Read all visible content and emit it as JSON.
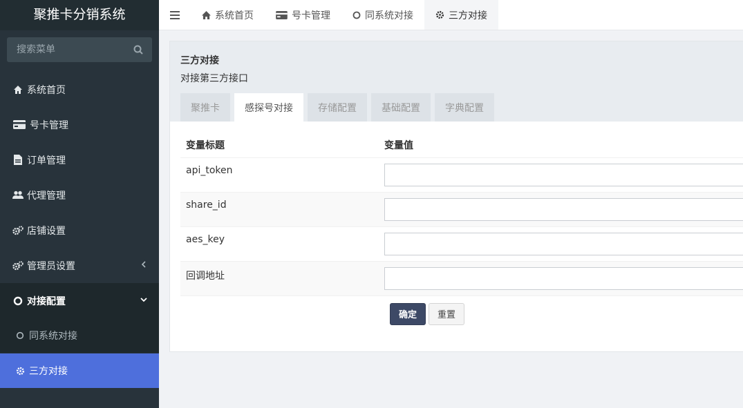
{
  "sidebar": {
    "brand": "聚推卡分销系统",
    "search_placeholder": "搜索菜单",
    "items": [
      {
        "label": "系统首页"
      },
      {
        "label": "号卡管理"
      },
      {
        "label": "订单管理"
      },
      {
        "label": "代理管理"
      },
      {
        "label": "店铺设置"
      },
      {
        "label": "管理员设置"
      },
      {
        "label": "对接配置"
      }
    ],
    "sub_items": [
      {
        "label": "同系统对接"
      },
      {
        "label": "三方对接"
      }
    ]
  },
  "topbar": {
    "tabs": [
      {
        "label": "系统首页"
      },
      {
        "label": "号卡管理"
      },
      {
        "label": "同系统对接"
      },
      {
        "label": "三方对接"
      }
    ]
  },
  "panel": {
    "title": "三方对接",
    "subtitle": "对接第三方接口",
    "tabs": [
      {
        "label": "聚推卡"
      },
      {
        "label": "感探号对接"
      },
      {
        "label": "存储配置"
      },
      {
        "label": "基础配置"
      },
      {
        "label": "字典配置"
      }
    ],
    "table": {
      "col1": "变量标题",
      "col2": "变量值",
      "rows": [
        {
          "label": "api_token",
          "value": ""
        },
        {
          "label": "share_id",
          "value": ""
        },
        {
          "label": "aes_key",
          "value": ""
        },
        {
          "label": "回调地址",
          "value": ""
        }
      ]
    },
    "buttons": {
      "confirm": "确定",
      "reset": "重置"
    }
  },
  "colors": {
    "sidebar_bg": "#28333b",
    "active_blue": "#4e6fdc",
    "primary_button": "#3d4966"
  }
}
